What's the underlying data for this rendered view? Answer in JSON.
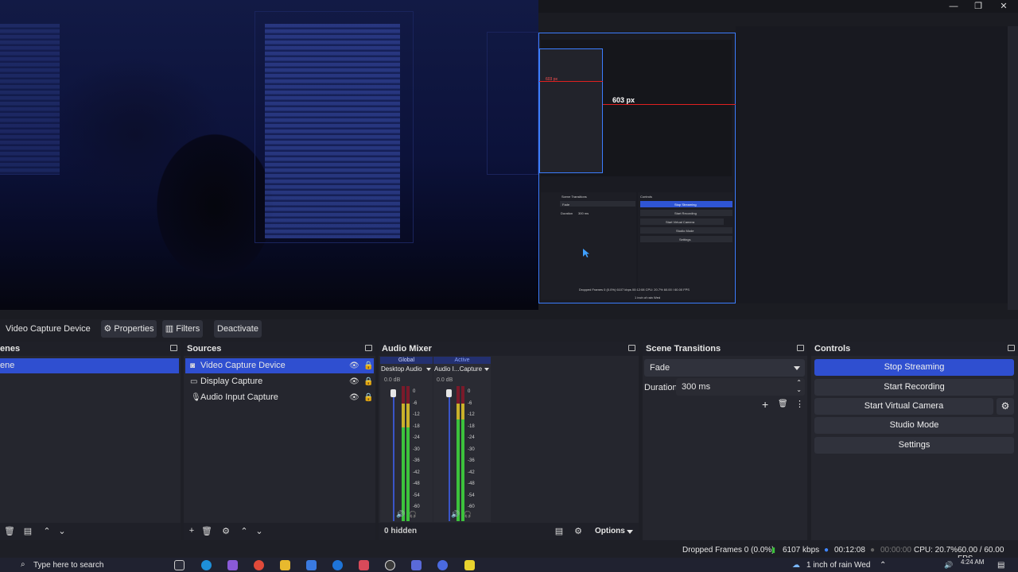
{
  "window": {
    "minimize_glyph": "—",
    "restore_glyph": "❐",
    "close_glyph": "✕"
  },
  "preview": {
    "measurement_label": "603 px",
    "nested_measure": "603 px",
    "nested_scene_transitions": "Scene Transitions",
    "nested_controls": "Controls",
    "nested_fade": "Fade",
    "nested_duration": "Duration",
    "nested_300": "300 ms",
    "nested_stop_streaming": "Stop Streaming",
    "nested_start_recording": "Start Recording",
    "nested_start_virtual": "Start Virtual Camera",
    "nested_studio": "Studio Mode",
    "nested_settings": "Settings",
    "nested_status": "Dropped Frames 0 (0.0%)  6107 kbps  00:12:08  CPU: 20.7%  60.00 / 60.00 FPS",
    "nested_taskbar": "1 inch of rain Wed"
  },
  "source_toolbar": {
    "source_name": "Video Capture Device",
    "properties_label": "Properties",
    "filters_label": "Filters",
    "deactivate_label": "Deactivate"
  },
  "scenes": {
    "title": "enes",
    "items": [
      {
        "label": "ene"
      }
    ]
  },
  "sources": {
    "title": "Sources",
    "items": [
      {
        "label": "Video Capture Device",
        "icon": "camera-icon"
      },
      {
        "label": "Display Capture",
        "icon": "monitor-icon"
      },
      {
        "label": "Audio Input Capture",
        "icon": "microphone-icon"
      }
    ]
  },
  "mixer": {
    "title": "Audio Mixer",
    "channels": [
      {
        "badge": "Global",
        "name": "Desktop Audio",
        "db": "0.0 dB"
      },
      {
        "badge": "Active",
        "name": "Audio I...Capture",
        "db": "0.0 dB"
      }
    ],
    "scale": [
      "0",
      "-6",
      "-12",
      "-18",
      "-24",
      "-30",
      "-36",
      "-42",
      "-48",
      "-54",
      "-60"
    ],
    "hidden_label": "0 hidden",
    "options_label": "Options"
  },
  "transitions": {
    "title": "Scene Transitions",
    "selected": "Fade",
    "duration_label": "Duration",
    "duration_value": "300 ms"
  },
  "controls": {
    "title": "Controls",
    "stop_streaming": "Stop Streaming",
    "start_recording": "Start Recording",
    "start_virtual_camera": "Start Virtual Camera",
    "studio_mode": "Studio Mode",
    "settings": "Settings"
  },
  "status": {
    "dropped_frames": "Dropped Frames 0 (0.0%)",
    "bitrate": "6107 kbps",
    "stream_time": "00:12:08",
    "record_time": "00:00:00",
    "cpu": "CPU: 20.7%",
    "fps": "60.00 / 60.00 FPS"
  },
  "taskbar": {
    "search_placeholder": "Type here to search",
    "weather": "1 inch of rain Wed",
    "time": "4:24 AM"
  },
  "colors": {
    "accent": "#2f4fd0",
    "panel": "#25262e",
    "meter_green": "#3cc23c",
    "meter_yellow": "#c9b12a",
    "meter_red": "#7a1a2a"
  }
}
